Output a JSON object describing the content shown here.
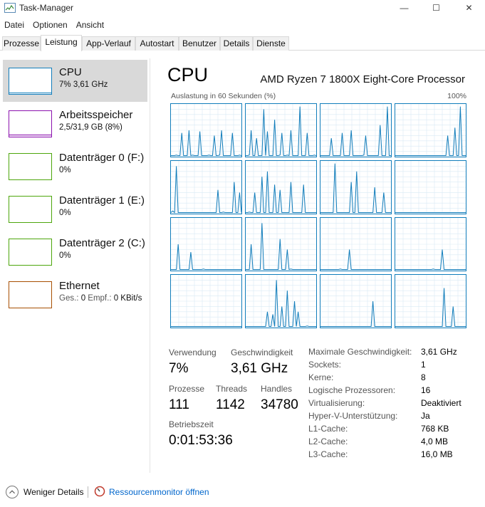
{
  "window": {
    "title": "Task-Manager",
    "controls": {
      "minimize": "—",
      "maximize": "☐",
      "close": "✕"
    }
  },
  "menu": [
    "Datei",
    "Optionen",
    "Ansicht"
  ],
  "tabs": [
    "Prozesse",
    "Leistung",
    "App-Verlauf",
    "Autostart",
    "Benutzer",
    "Details",
    "Dienste"
  ],
  "active_tab": "Leistung",
  "sidebar": {
    "items": [
      {
        "name": "CPU",
        "sub": "7%  3,61 GHz",
        "color": "#117dbb",
        "selected": true
      },
      {
        "name": "Arbeitsspeicher",
        "sub": "2,5/31,9 GB (8%)",
        "color": "#8b12ae",
        "selected": false
      },
      {
        "name": "Datenträger 0 (F:)",
        "sub": "0%",
        "color": "#4da60c",
        "selected": false
      },
      {
        "name": "Datenträger 1 (E:)",
        "sub": "0%",
        "color": "#4da60c",
        "selected": false
      },
      {
        "name": "Datenträger 2 (C:)",
        "sub": "0%",
        "color": "#4da60c",
        "selected": false
      },
      {
        "name": "Ethernet",
        "sub_prefix": "Ges.: ",
        "sub_send": "0",
        "sub_mid": " Empf.: ",
        "sub_recv": "0 KBit/s",
        "color": "#a74f01",
        "selected": false
      }
    ]
  },
  "main": {
    "title": "CPU",
    "model": "AMD Ryzen 7 1800X Eight-Core Processor",
    "graph_caption": "Auslastung in 60 Sekunden (%)",
    "graph_max": "100%",
    "stats": {
      "verwendung_label": "Verwendung",
      "verwendung": "7%",
      "geschwindigkeit_label": "Geschwindigkeit",
      "geschwindigkeit": "3,61 GHz",
      "prozesse_label": "Prozesse",
      "prozesse": "111",
      "threads_label": "Threads",
      "threads": "1142",
      "handles_label": "Handles",
      "handles": "34780",
      "betriebszeit_label": "Betriebszeit",
      "betriebszeit": "0:01:53:36"
    },
    "details": [
      {
        "label": "Maximale Geschwindigkeit:",
        "value": "3,61 GHz"
      },
      {
        "label": "Sockets:",
        "value": "1"
      },
      {
        "label": "Kerne:",
        "value": "8"
      },
      {
        "label": "Logische Prozessoren:",
        "value": "16"
      },
      {
        "label": "Virtualisierung:",
        "value": "Deaktiviert"
      },
      {
        "label": "Hyper-V-Unterstützung:",
        "value": "Ja"
      },
      {
        "label": "L1-Cache:",
        "value": "768 KB"
      },
      {
        "label": "L2-Cache:",
        "value": "4,0 MB"
      },
      {
        "label": "L3-Cache:",
        "value": "16,0 MB"
      }
    ]
  },
  "footer": {
    "less_details": "Weniger Details",
    "resource_monitor": "Ressourcenmonitor öffnen"
  },
  "colors": {
    "cpu_line": "#117dbb",
    "cpu_grid": "#d9eaf4",
    "link": "#0066cc"
  },
  "chart_data": {
    "type": "line",
    "title": "Auslastung in 60 Sekunden (%)",
    "ylim": [
      0,
      100
    ],
    "series": [
      {
        "values": [
          2,
          2,
          2,
          3,
          2,
          2,
          45,
          2,
          2,
          2,
          50,
          2,
          3,
          2,
          2,
          2,
          48,
          2,
          2,
          2,
          2,
          3,
          2,
          2,
          40,
          2,
          2,
          3,
          50,
          2,
          2,
          2,
          2,
          2,
          45,
          2,
          2,
          2,
          3,
          2
        ]
      },
      {
        "values": [
          2,
          2,
          3,
          50,
          2,
          2,
          35,
          2,
          2,
          2,
          90,
          2,
          48,
          2,
          2,
          2,
          70,
          2,
          2,
          3,
          45,
          2,
          2,
          3,
          2,
          50,
          2,
          2,
          2,
          2,
          95,
          2,
          2,
          2,
          45,
          2,
          2,
          2,
          3,
          2
        ]
      },
      {
        "values": [
          2,
          2,
          2,
          2,
          2,
          2,
          35,
          2,
          2,
          2,
          2,
          2,
          45,
          2,
          2,
          2,
          2,
          50,
          2,
          2,
          2,
          2,
          2,
          2,
          3,
          40,
          2,
          2,
          2,
          2,
          2,
          2,
          2,
          60,
          2,
          2,
          2,
          95,
          2,
          2
        ]
      },
      {
        "values": [
          2,
          2,
          2,
          2,
          2,
          2,
          2,
          2,
          2,
          2,
          2,
          2,
          2,
          2,
          2,
          2,
          2,
          2,
          2,
          2,
          2,
          2,
          2,
          2,
          2,
          2,
          2,
          2,
          2,
          40,
          2,
          2,
          2,
          55,
          2,
          2,
          95,
          2,
          2,
          2
        ]
      },
      {
        "values": [
          2,
          5,
          2,
          90,
          2,
          2,
          2,
          2,
          2,
          2,
          2,
          2,
          2,
          2,
          2,
          2,
          2,
          2,
          2,
          2,
          2,
          2,
          2,
          2,
          2,
          2,
          45,
          2,
          2,
          3,
          2,
          2,
          2,
          2,
          2,
          60,
          2,
          2,
          40,
          2
        ]
      },
      {
        "values": [
          2,
          2,
          3,
          2,
          2,
          40,
          2,
          2,
          2,
          70,
          2,
          2,
          80,
          2,
          2,
          2,
          55,
          2,
          2,
          45,
          2,
          2,
          2,
          2,
          2,
          60,
          2,
          2,
          2,
          2,
          2,
          2,
          55,
          2,
          2,
          2,
          2,
          2,
          2,
          2
        ]
      },
      {
        "values": [
          2,
          2,
          2,
          2,
          2,
          2,
          2,
          2,
          95,
          2,
          2,
          2,
          2,
          2,
          2,
          2,
          2,
          60,
          2,
          2,
          80,
          2,
          2,
          2,
          2,
          2,
          2,
          2,
          2,
          2,
          50,
          2,
          2,
          2,
          2,
          40,
          2,
          2,
          2,
          2
        ]
      },
      {
        "values": [
          2,
          2,
          2,
          2,
          2,
          2,
          2,
          2,
          2,
          2,
          2,
          2,
          2,
          2,
          2,
          2,
          2,
          2,
          2,
          2,
          2,
          2,
          2,
          2,
          2,
          2,
          2,
          2,
          2,
          2,
          2,
          2,
          2,
          2,
          2,
          2,
          2,
          2,
          2,
          2
        ]
      },
      {
        "values": [
          2,
          2,
          2,
          2,
          50,
          2,
          2,
          2,
          2,
          2,
          2,
          35,
          2,
          2,
          2,
          2,
          2,
          2,
          3,
          2,
          2,
          2,
          2,
          2,
          2,
          2,
          2,
          2,
          2,
          2,
          2,
          2,
          2,
          2,
          2,
          2,
          2,
          2,
          2,
          2
        ]
      },
      {
        "values": [
          2,
          2,
          2,
          50,
          2,
          2,
          2,
          2,
          2,
          90,
          2,
          2,
          2,
          2,
          2,
          2,
          2,
          2,
          2,
          60,
          2,
          2,
          2,
          40,
          2,
          3,
          2,
          2,
          2,
          2,
          2,
          2,
          2,
          2,
          2,
          2,
          2,
          2,
          2,
          2
        ]
      },
      {
        "values": [
          2,
          2,
          2,
          2,
          2,
          2,
          2,
          2,
          2,
          2,
          2,
          3,
          2,
          2,
          2,
          2,
          40,
          2,
          2,
          2,
          2,
          2,
          2,
          2,
          2,
          2,
          2,
          2,
          2,
          2,
          2,
          2,
          2,
          2,
          2,
          2,
          2,
          2,
          2,
          2
        ]
      },
      {
        "values": [
          2,
          2,
          2,
          2,
          2,
          2,
          2,
          2,
          2,
          2,
          2,
          2,
          2,
          2,
          2,
          2,
          2,
          2,
          2,
          2,
          2,
          3,
          2,
          2,
          2,
          2,
          40,
          2,
          2,
          2,
          2,
          2,
          2,
          2,
          2,
          2,
          2,
          2,
          2,
          2
        ]
      },
      {
        "values": [
          2,
          2,
          2,
          2,
          2,
          2,
          2,
          2,
          2,
          2,
          2,
          2,
          2,
          2,
          2,
          2,
          2,
          2,
          2,
          2,
          2,
          2,
          2,
          2,
          2,
          2,
          2,
          2,
          2,
          2,
          2,
          2,
          2,
          2,
          2,
          2,
          2,
          2,
          2,
          2
        ]
      },
      {
        "values": [
          2,
          2,
          2,
          2,
          2,
          2,
          2,
          2,
          2,
          2,
          2,
          2,
          30,
          2,
          2,
          25,
          2,
          90,
          2,
          2,
          40,
          2,
          2,
          70,
          2,
          2,
          2,
          50,
          2,
          30,
          2,
          2,
          2,
          2,
          3,
          2,
          2,
          2,
          2,
          2
        ]
      },
      {
        "values": [
          2,
          2,
          2,
          2,
          2,
          2,
          2,
          2,
          2,
          2,
          2,
          2,
          2,
          2,
          2,
          2,
          2,
          2,
          2,
          2,
          2,
          2,
          2,
          2,
          2,
          2,
          2,
          2,
          2,
          50,
          2,
          2,
          2,
          2,
          2,
          2,
          2,
          2,
          2,
          2
        ]
      },
      {
        "values": [
          2,
          2,
          2,
          2,
          2,
          2,
          2,
          2,
          2,
          2,
          2,
          2,
          2,
          2,
          2,
          2,
          2,
          2,
          2,
          2,
          2,
          2,
          2,
          2,
          2,
          2,
          2,
          75,
          2,
          2,
          2,
          2,
          40,
          2,
          2,
          2,
          2,
          2,
          2,
          2
        ]
      }
    ]
  }
}
